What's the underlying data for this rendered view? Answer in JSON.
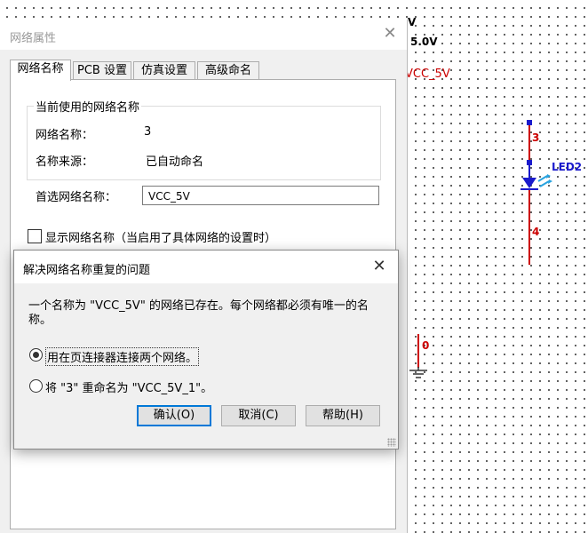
{
  "schematic": {
    "power_symbol_text": "V",
    "power_voltage": "5.0V",
    "power_net_label": "VCC_5V",
    "net_top_label": "3",
    "led_ref": "LED2",
    "net_bottom_label": "4",
    "ground_net_label": "0"
  },
  "net_properties": {
    "title": "网络属性",
    "tabs": [
      "网络名称",
      "PCB 设置",
      "仿真设置",
      "高级命名"
    ],
    "group_title": "当前使用的网络名称",
    "net_name_label": "网络名称：",
    "net_name_value": "3",
    "name_source_label": "名称来源：",
    "name_source_value": "已自动命名",
    "preferred_label": "首选网络名称：",
    "preferred_value": "VCC_5V",
    "show_name_checkbox": "显示网络名称（当启用了具体网络的设置时）",
    "show_name_checked": false
  },
  "conflict_dialog": {
    "title": "解决网络名称重复的问题",
    "message": "一个名称为 \"VCC_5V\" 的网络已存在。每个网络都必须有唯一的名称。",
    "options": [
      {
        "label": "用在页连接器连接两个网络。",
        "selected": true
      },
      {
        "label": "将 \"3\" 重命名为 \"VCC_5V_1\"。",
        "selected": false
      }
    ],
    "buttons": {
      "ok": "确认(O)",
      "cancel": "取消(C)",
      "help": "帮助(H)"
    }
  },
  "colors": {
    "wire": "#cc0000",
    "node": "#1a1acc",
    "power_label": "#cc0000",
    "accent": "#0078d7"
  }
}
